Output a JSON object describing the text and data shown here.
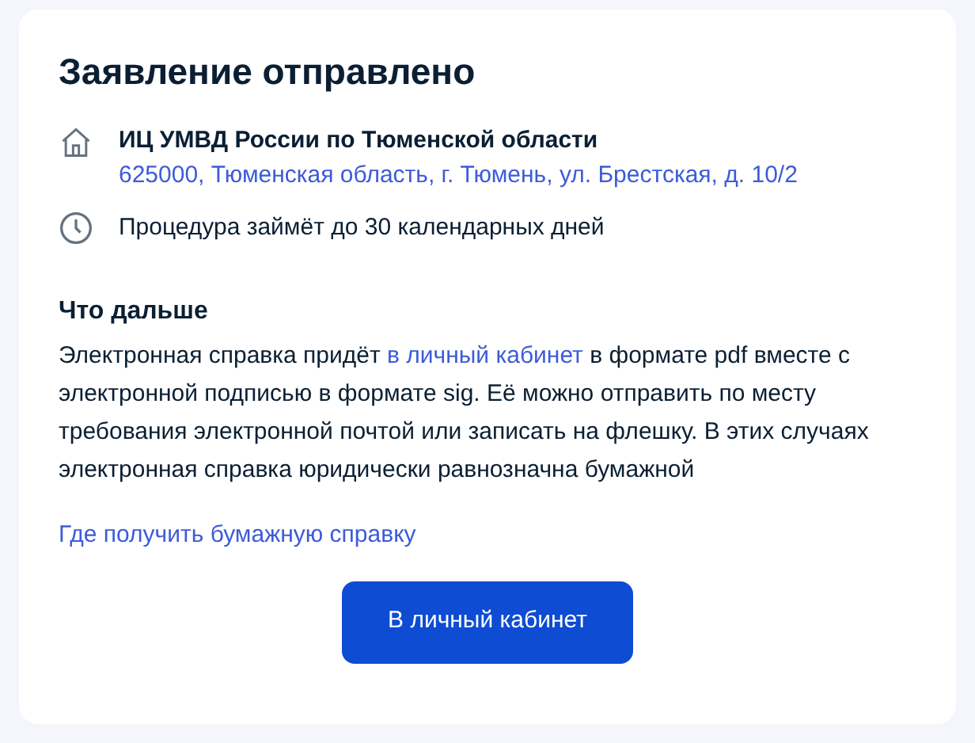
{
  "title": "Заявление отправлено",
  "office": {
    "name": "ИЦ УМВД России по Тюменской области",
    "address": "625000, Тюменская область, г. Тюмень, ул. Брестская, д. 10/2"
  },
  "duration": "Процедура займёт до 30 календарных дней",
  "next": {
    "heading": "Что дальше",
    "text_before": "Электронная справка придёт",
    "link": "в личный кабинет",
    "text_after": "в формате pdf вместе с электронной подписью в формате sig. Её можно отправить по месту требования электронной почтой или записать на флешку. В этих случаях электронная справка юридически равнозначна бумажной"
  },
  "paper_link": "Где получить бумажную справку",
  "button": "В личный кабинет"
}
